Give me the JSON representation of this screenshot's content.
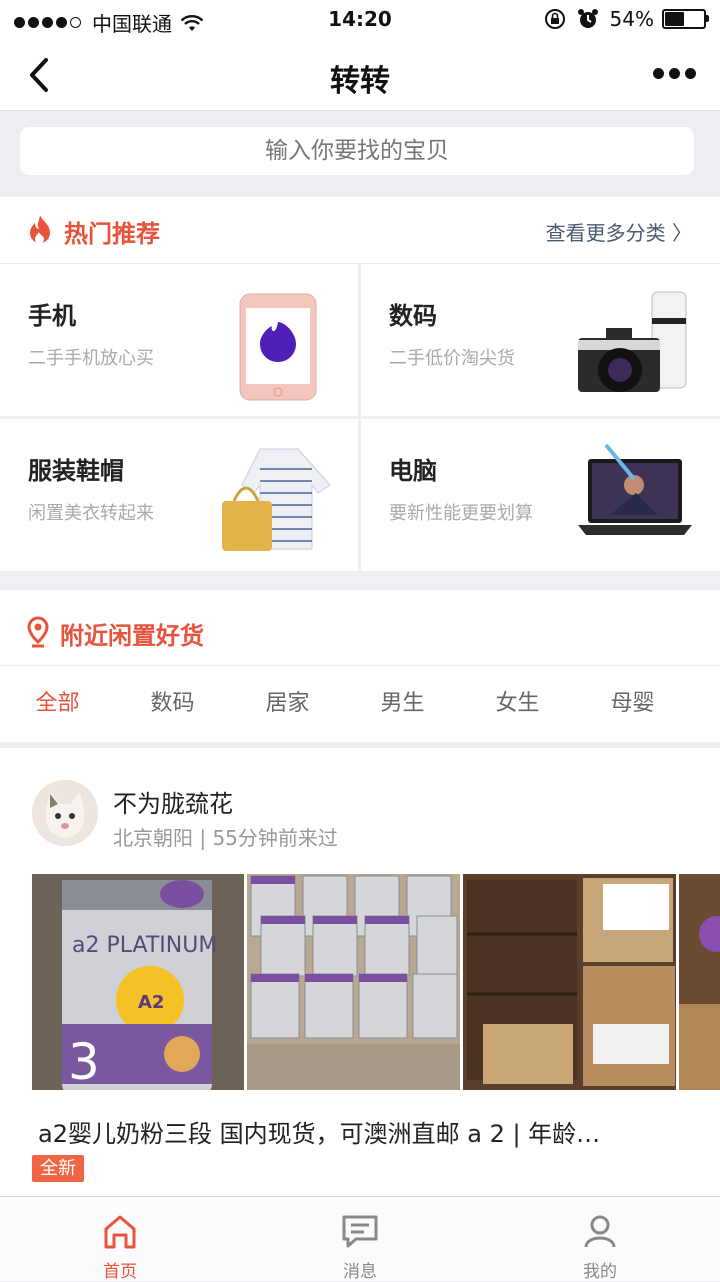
{
  "status": {
    "carrier": "中国联通",
    "time": "14:20",
    "battery": "54%",
    "battery_level": 0.54
  },
  "nav": {
    "title": "转转",
    "back_icon": "chevron-left-icon",
    "more_icon": "more-dots-icon"
  },
  "search": {
    "placeholder": "输入你要找的宝贝"
  },
  "hot": {
    "title": "热门推荐",
    "more": "查看更多分类",
    "categories": [
      {
        "name": "手机",
        "desc": "二手手机放心买",
        "icon": "phone-image"
      },
      {
        "name": "数码",
        "desc": "二手低价淘尖货",
        "icon": "camera-image"
      },
      {
        "name": "服装鞋帽",
        "desc": "闲置美衣转起来",
        "icon": "clothes-image"
      },
      {
        "name": "电脑",
        "desc": "要新性能更要划算",
        "icon": "laptop-image"
      }
    ]
  },
  "nearby": {
    "title": "附近闲置好货",
    "tabs": [
      "全部",
      "数码",
      "居家",
      "男生",
      "女生",
      "母婴"
    ],
    "active_tab": 0
  },
  "listing": {
    "seller": "不为胧巯花",
    "meta": "北京朝阳 | 55分钟前来过",
    "title": "a2婴儿奶粉三段 国内现货，可澳洲直邮 a 2 | 年龄…",
    "badge": "全新",
    "can_text": "a2 PLATINUM",
    "can_sub": "A2",
    "can_num": "3"
  },
  "tabbar": {
    "items": [
      {
        "label": "首页",
        "icon": "home-icon"
      },
      {
        "label": "消息",
        "icon": "message-icon"
      },
      {
        "label": "我的",
        "icon": "user-icon"
      }
    ],
    "active": 0
  },
  "colors": {
    "accent": "#e8533c",
    "background": "#f1eff3"
  }
}
